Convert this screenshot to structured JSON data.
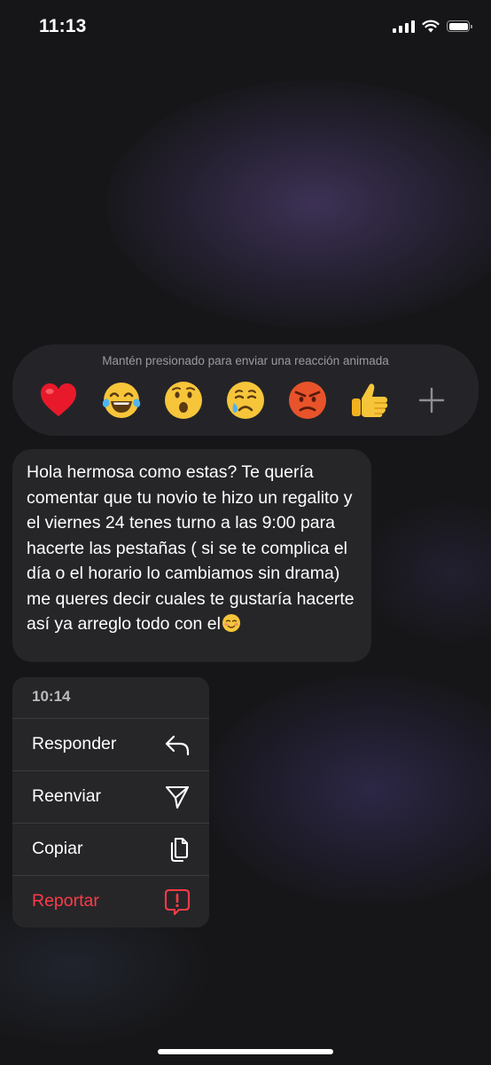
{
  "status_bar": {
    "time": "11:13"
  },
  "reaction_bar": {
    "hint": "Mantén presionado para enviar una reacción animada",
    "reactions": [
      {
        "icon": "red-heart-emoji"
      },
      {
        "icon": "tears-of-joy-emoji"
      },
      {
        "icon": "surprised-face-emoji"
      },
      {
        "icon": "crying-face-emoji"
      },
      {
        "icon": "angry-face-emoji"
      },
      {
        "icon": "thumbs-up-emoji"
      },
      {
        "icon": "plus-icon"
      }
    ]
  },
  "message": {
    "text": "Hola hermosa como estas? Te quería comentar que tu novio te hizo un regalito y el viernes 24 tenes turno a las 9:00 para hacerte las pestañas ( si se te complica el día o el horario lo cambiamos sin drama) me queres decir cuales te gustaría hacerte así ya arreglo todo con el",
    "trailing_emoji": "smiling-face-emoji"
  },
  "context_menu": {
    "time": "10:14",
    "items": [
      {
        "label": "Responder",
        "icon": "reply-icon"
      },
      {
        "label": "Reenviar",
        "icon": "send-icon"
      },
      {
        "label": "Copiar",
        "icon": "copy-icon"
      },
      {
        "label": "Reportar",
        "icon": "report-icon",
        "color": "#ff3b47"
      }
    ]
  },
  "colors": {
    "background": "#161618",
    "bubble": "#262629",
    "danger": "#ff3b47"
  }
}
